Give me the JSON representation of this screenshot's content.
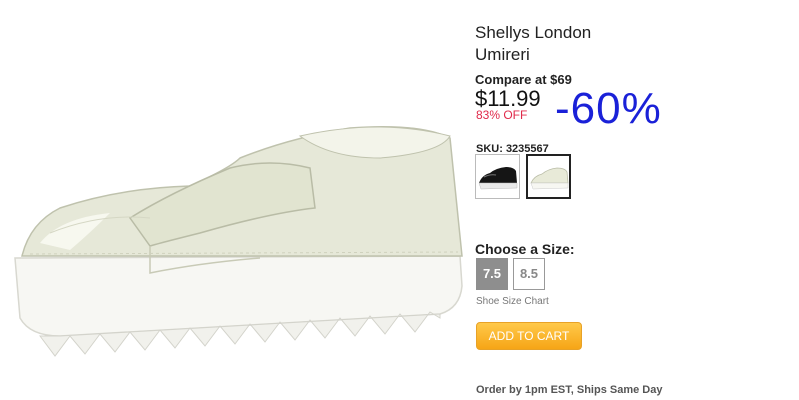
{
  "product": {
    "brand": "Shellys London",
    "model": "Umireri",
    "compare_label": "Compare at $69",
    "price": "$11.99",
    "off_label": "83% OFF",
    "discount_badge": "-60%",
    "sku_label": "SKU: 3235567"
  },
  "swatches": [
    {
      "name": "black-shoe-swatch",
      "color": "#1a1a1a"
    },
    {
      "name": "white-shoe-swatch",
      "color": "#f2f2e8"
    }
  ],
  "sizes": {
    "title": "Choose a Size:",
    "options": [
      "7.5",
      "8.5"
    ],
    "selected": "7.5",
    "chart_link": "Shoe Size Chart"
  },
  "cart": {
    "button_label": "ADD TO CART"
  },
  "shipping": {
    "note": "Order by 1pm EST, Ships Same Day"
  },
  "colors": {
    "accent_price_off": "#e0294a",
    "discount_blue": "#1a21d8",
    "cart_orange": "#f6a516"
  },
  "icons": {
    "product_image": "white-patent-platform-slip-on-shoe"
  }
}
